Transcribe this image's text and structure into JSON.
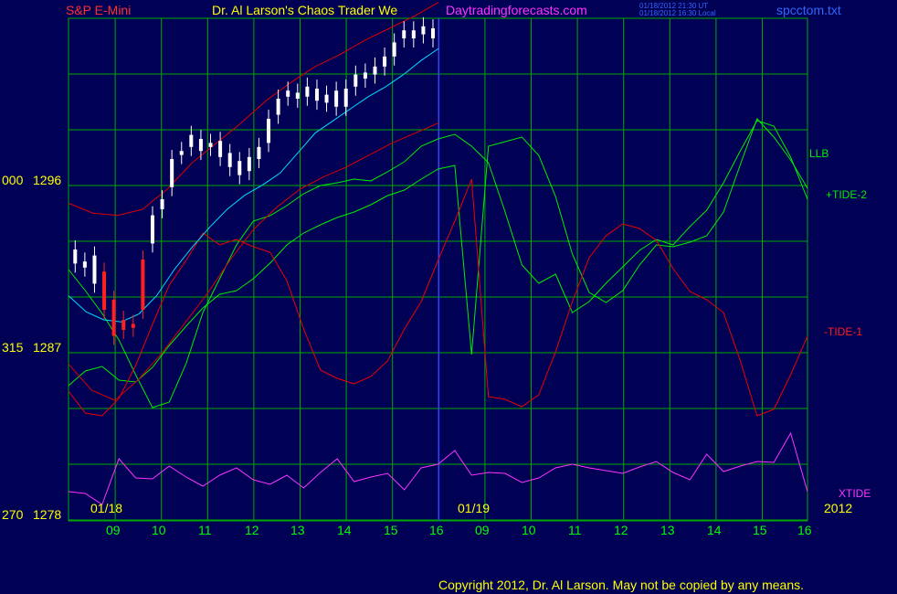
{
  "header": {
    "symbol": "S&P E-Mini",
    "title": "Dr. Al Larson's Chaos Trader We",
    "site": "Daytradingforecasts.com",
    "timestamp_ut": "01/18/2012 21:30 UT",
    "timestamp_local": "01/18/2012 16:30 Local",
    "file": "spcctom.txt"
  },
  "copyright": "Copyright 2012, Dr. Al Larson. May not be copied by any means.",
  "colors": {
    "background": "#000055",
    "grid": "#00aa00",
    "price_up": "#ffffff",
    "price_down": "#ff2020",
    "llb": "#00ee00",
    "tide2": "#00ee00",
    "tide1": "#ee0000",
    "xtide": "#ff33ff",
    "ma": "#00ddff"
  },
  "chart_data": {
    "type": "line",
    "y_ticks": [
      {
        "left": "000",
        "right": "1296"
      },
      {
        "left": "315",
        "right": "1287"
      },
      {
        "left": "270",
        "right": "1278"
      }
    ],
    "ylim": [
      1278,
      1303
    ],
    "x_day_labels": [
      "09",
      "10",
      "11",
      "12",
      "13",
      "14",
      "15",
      "16",
      "09",
      "10",
      "11",
      "12",
      "13",
      "14",
      "15",
      "16"
    ],
    "date_labels": [
      "01/18",
      "01/19",
      "2012"
    ],
    "now_index": 8,
    "series_labels": {
      "llb": "LLB",
      "tide2": "+TIDE-2",
      "tide1": "-TIDE-1",
      "xtide": "XTIDE"
    },
    "price": [
      [
        1291.5,
        1290.8
      ],
      [
        1290.9,
        1290.6
      ],
      [
        1291.2,
        1289.8
      ],
      [
        1290.4,
        1288.5
      ],
      [
        1289.0,
        1287.2
      ],
      [
        1288.0,
        1287.5
      ],
      [
        1287.6,
        1287.8
      ],
      [
        1288.5,
        1291.0
      ],
      [
        1291.8,
        1293.2
      ],
      [
        1293.5,
        1294.0
      ],
      [
        1294.6,
        1296.0
      ],
      [
        1296.2,
        1296.4
      ],
      [
        1296.6,
        1297.2
      ],
      [
        1297.0,
        1296.4
      ],
      [
        1296.6,
        1296.8
      ],
      [
        1296.9,
        1296.1
      ],
      [
        1296.3,
        1295.6
      ],
      [
        1295.9,
        1295.2
      ],
      [
        1295.4,
        1296.1
      ],
      [
        1296.0,
        1296.6
      ],
      [
        1296.8,
        1298.0
      ],
      [
        1298.2,
        1299.0
      ],
      [
        1299.4,
        1299.1
      ],
      [
        1299.0,
        1299.3
      ],
      [
        1299.1,
        1299.6
      ],
      [
        1299.5,
        1298.9
      ],
      [
        1298.8,
        1299.2
      ],
      [
        1299.4,
        1298.6
      ],
      [
        1298.6,
        1299.5
      ],
      [
        1299.6,
        1300.2
      ],
      [
        1300.3,
        1300.0
      ],
      [
        1300.2,
        1300.6
      ],
      [
        1300.6,
        1301.1
      ],
      [
        1301.1,
        1301.8
      ],
      [
        1302.0,
        1302.4
      ],
      [
        1302.4,
        1302.0
      ],
      [
        1302.2,
        1302.6
      ],
      [
        1302.5,
        1302.0
      ]
    ],
    "ma": [
      1289.2,
      1288.4,
      1288.0,
      1287.9,
      1288.3,
      1289.2,
      1290.5,
      1291.6,
      1292.6,
      1293.5,
      1294.2,
      1294.7,
      1295.3,
      1296.3,
      1297.3,
      1297.9,
      1298.5,
      1299.1,
      1299.6,
      1300.2,
      1300.9,
      1301.5
    ],
    "upper_band": [
      1293.8,
      1293.3,
      1293.2,
      1293.5,
      1294.5,
      1295.8,
      1296.8,
      1297.8,
      1298.9,
      1299.8,
      1300.6,
      1301.2,
      1301.9,
      1302.5,
      1303.1,
      1303.8
    ],
    "lower_band": [
      1285.8,
      1284.5,
      1284.0,
      1285.0,
      1286.3,
      1287.8,
      1289.3,
      1291.0,
      1292.5,
      1293.6,
      1294.5,
      1295.1,
      1295.6,
      1296.2,
      1296.8,
      1297.3,
      1297.8
    ],
    "llb": [
      295,
      318,
      343,
      372,
      410,
      446,
      440,
      398,
      342,
      305,
      268,
      242,
      236,
      225,
      212,
      203,
      200,
      196,
      198,
      188,
      177,
      160,
      152,
      147,
      160,
      178,
      232,
      290,
      310,
      300,
      342,
      330,
      310,
      292,
      274,
      262,
      268,
      248,
      230,
      200,
      165,
      132,
      138,
      172,
      218
    ],
    "tide2": [
      422,
      406,
      401,
      416,
      418,
      402,
      378,
      357,
      337,
      322,
      318,
      305,
      288,
      268,
      255,
      246,
      238,
      232,
      224,
      214,
      208,
      196,
      185,
      181,
      388,
      160,
      155,
      150,
      170,
      215,
      278,
      320,
      331,
      318,
      290,
      268,
      270,
      265,
      258,
      232,
      180,
      130,
      150,
      175,
      206
    ],
    "tide1": [
      428,
      452,
      455,
      436,
      400,
      355,
      312,
      285,
      255,
      268,
      262,
      270,
      276,
      307,
      360,
      405,
      414,
      420,
      412,
      395,
      360,
      330,
      285,
      242,
      196,
      434,
      437,
      445,
      432,
      385,
      330,
      282,
      258,
      245,
      250,
      263,
      294,
      319,
      328,
      342,
      395,
      455,
      448,
      410,
      368
    ],
    "xtide": [
      538,
      540,
      552,
      502,
      523,
      524,
      510,
      522,
      532,
      520,
      512,
      525,
      530,
      520,
      534,
      517,
      502,
      527,
      522,
      518,
      536,
      512,
      508,
      493,
      520,
      517,
      518,
      528,
      523,
      512,
      508,
      512,
      515,
      518,
      511,
      505,
      517,
      525,
      497,
      516,
      510,
      505,
      506,
      474,
      538
    ]
  }
}
